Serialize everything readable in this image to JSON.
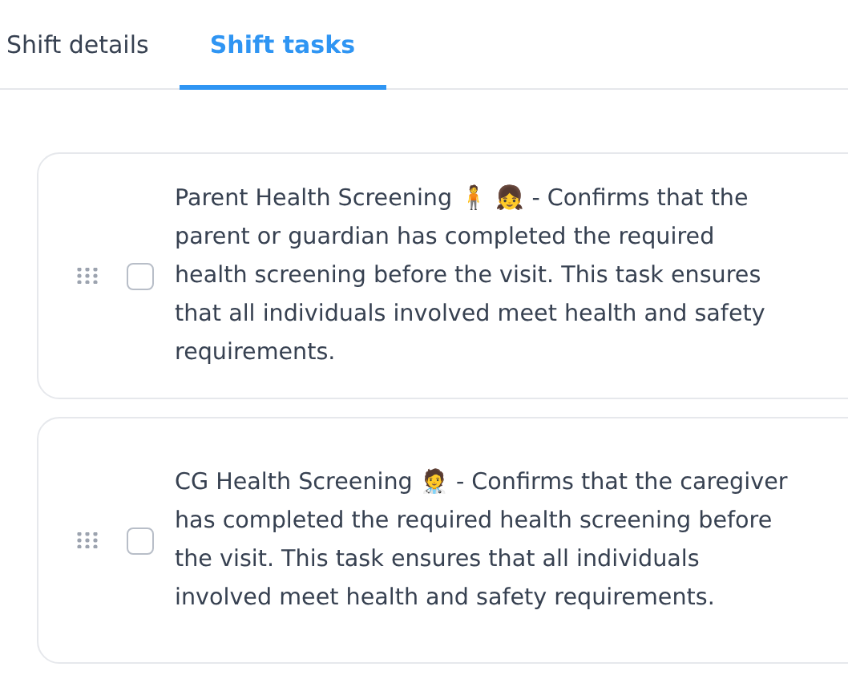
{
  "tabs": [
    {
      "label": "Shift details",
      "selected": false
    },
    {
      "label": "Shift tasks",
      "selected": true
    }
  ],
  "tasks": [
    {
      "text": "Parent Health Screening 🧍 👧 - Confirms that the parent or guardian has completed the required health screening before the visit. This task ensures that all individuals involved meet health and safety requirements.",
      "checked": false
    },
    {
      "text": "CG Health Screening 🧑‍⚕️ - Confirms that the caregiver has completed the required health screening before the visit. This task ensures that all individuals involved meet health and safety requirements.",
      "checked": false
    }
  ]
}
